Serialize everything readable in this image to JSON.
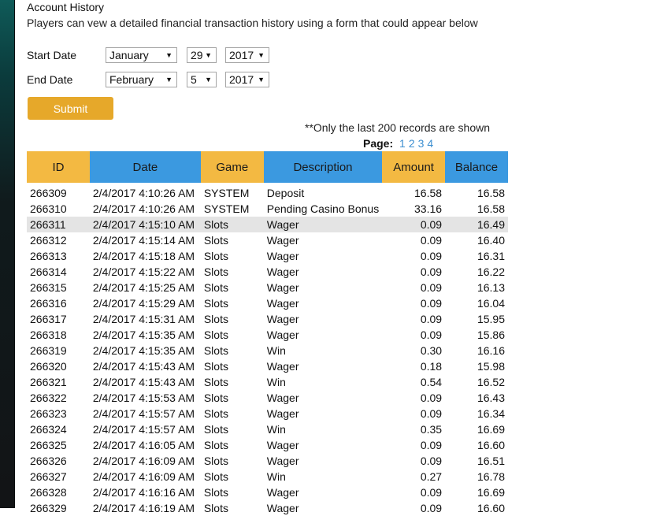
{
  "page": {
    "title": "Account History",
    "description": "Players can vew a detailed financial transaction history using a form that could appear below"
  },
  "form": {
    "start_label": "Start Date",
    "end_label": "End Date",
    "start": {
      "month": "January",
      "day": "29",
      "year": "2017"
    },
    "end": {
      "month": "February",
      "day": "5",
      "year": "2017"
    },
    "submit_label": "Submit"
  },
  "records_note": "**Only the last 200 records are shown",
  "pager": {
    "label": "Page:",
    "pages": [
      "1",
      "2",
      "3",
      "4"
    ]
  },
  "table": {
    "headers": [
      "ID",
      "Date",
      "Game",
      "Description",
      "Amount",
      "Balance"
    ],
    "rows": [
      [
        "266309",
        "2/4/2017 4:10:26 AM",
        "SYSTEM",
        "Deposit",
        "16.58",
        "16.58"
      ],
      [
        "266310",
        "2/4/2017 4:10:26 AM",
        "SYSTEM",
        "Pending Casino Bonus",
        "33.16",
        "16.58"
      ],
      [
        "266311",
        "2/4/2017 4:15:10 AM",
        "Slots",
        "Wager",
        "0.09",
        "16.49"
      ],
      [
        "266312",
        "2/4/2017 4:15:14 AM",
        "Slots",
        "Wager",
        "0.09",
        "16.40"
      ],
      [
        "266313",
        "2/4/2017 4:15:18 AM",
        "Slots",
        "Wager",
        "0.09",
        "16.31"
      ],
      [
        "266314",
        "2/4/2017 4:15:22 AM",
        "Slots",
        "Wager",
        "0.09",
        "16.22"
      ],
      [
        "266315",
        "2/4/2017 4:15:25 AM",
        "Slots",
        "Wager",
        "0.09",
        "16.13"
      ],
      [
        "266316",
        "2/4/2017 4:15:29 AM",
        "Slots",
        "Wager",
        "0.09",
        "16.04"
      ],
      [
        "266317",
        "2/4/2017 4:15:31 AM",
        "Slots",
        "Wager",
        "0.09",
        "15.95"
      ],
      [
        "266318",
        "2/4/2017 4:15:35 AM",
        "Slots",
        "Wager",
        "0.09",
        "15.86"
      ],
      [
        "266319",
        "2/4/2017 4:15:35 AM",
        "Slots",
        "Win",
        "0.30",
        "16.16"
      ],
      [
        "266320",
        "2/4/2017 4:15:43 AM",
        "Slots",
        "Wager",
        "0.18",
        "15.98"
      ],
      [
        "266321",
        "2/4/2017 4:15:43 AM",
        "Slots",
        "Win",
        "0.54",
        "16.52"
      ],
      [
        "266322",
        "2/4/2017 4:15:53 AM",
        "Slots",
        "Wager",
        "0.09",
        "16.43"
      ],
      [
        "266323",
        "2/4/2017 4:15:57 AM",
        "Slots",
        "Wager",
        "0.09",
        "16.34"
      ],
      [
        "266324",
        "2/4/2017 4:15:57 AM",
        "Slots",
        "Win",
        "0.35",
        "16.69"
      ],
      [
        "266325",
        "2/4/2017 4:16:05 AM",
        "Slots",
        "Wager",
        "0.09",
        "16.60"
      ],
      [
        "266326",
        "2/4/2017 4:16:09 AM",
        "Slots",
        "Wager",
        "0.09",
        "16.51"
      ],
      [
        "266327",
        "2/4/2017 4:16:09 AM",
        "Slots",
        "Win",
        "0.27",
        "16.78"
      ],
      [
        "266328",
        "2/4/2017 4:16:16 AM",
        "Slots",
        "Wager",
        "0.09",
        "16.69"
      ],
      [
        "266329",
        "2/4/2017 4:16:19 AM",
        "Slots",
        "Wager",
        "0.09",
        "16.60"
      ]
    ],
    "highlighted_row": 2
  },
  "colors": {
    "accent_gold": "#f3b942",
    "accent_blue": "#3b99e0",
    "button": "#e6a82a",
    "link": "#3d8fd0"
  }
}
